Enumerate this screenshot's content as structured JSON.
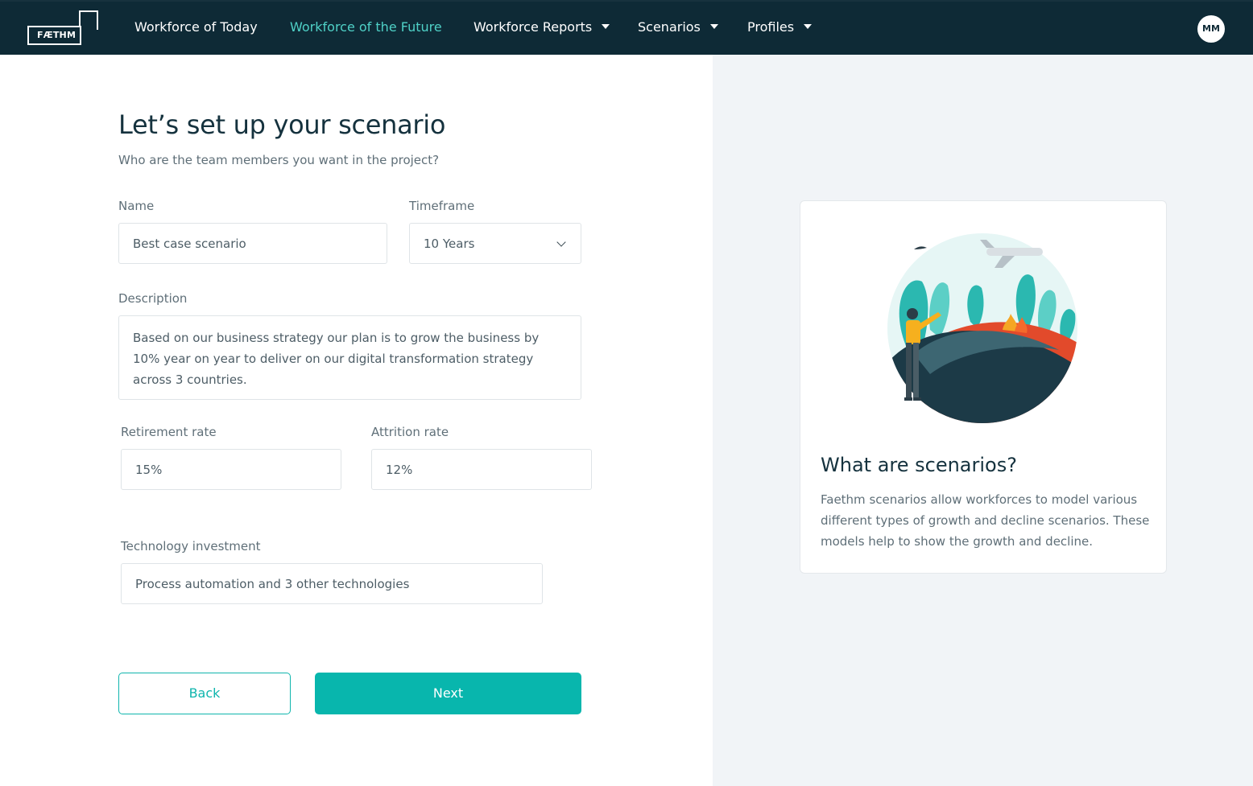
{
  "nav": {
    "logo_text": "FÆTHM",
    "items": [
      {
        "label": "Workforce of Today",
        "active": false,
        "dropdown": false
      },
      {
        "label": "Workforce of the Future",
        "active": true,
        "dropdown": false
      },
      {
        "label": "Workforce Reports",
        "active": false,
        "dropdown": true
      },
      {
        "label": "Scenarios",
        "active": false,
        "dropdown": true
      },
      {
        "label": "Profiles",
        "active": false,
        "dropdown": true
      }
    ],
    "avatar_initials": "MM",
    "colors": {
      "background": "#0e2a36",
      "active": "#4fd1c7"
    }
  },
  "form": {
    "title": "Let’s set up your scenario",
    "subtitle": "Who are the team members you want in the project?",
    "name": {
      "label": "Name",
      "value": "Best case scenario"
    },
    "timeframe": {
      "label": "Timeframe",
      "value": "10 Years"
    },
    "description": {
      "label": "Description",
      "value": "Based on our business strategy our plan is to grow the business by 10% year on year to deliver on our digital transformation strategy across 3 countries."
    },
    "retirement": {
      "label": "Retirement rate",
      "value": "15%"
    },
    "attrition": {
      "label": "Attrition rate",
      "value": "12%"
    },
    "technology": {
      "label": "Technology investment",
      "value": "Process automation and 3 other technologies"
    },
    "back_label": "Back",
    "next_label": "Next",
    "accent": "#08b6ad"
  },
  "info_card": {
    "title": "What are scenarios?",
    "text": "Faethm scenarios allow workforces to model various different types of growth and decline scenarios. These models help to show the growth and decline.",
    "illustration": "person-on-hill-with-fire-and-plane-illustration"
  }
}
